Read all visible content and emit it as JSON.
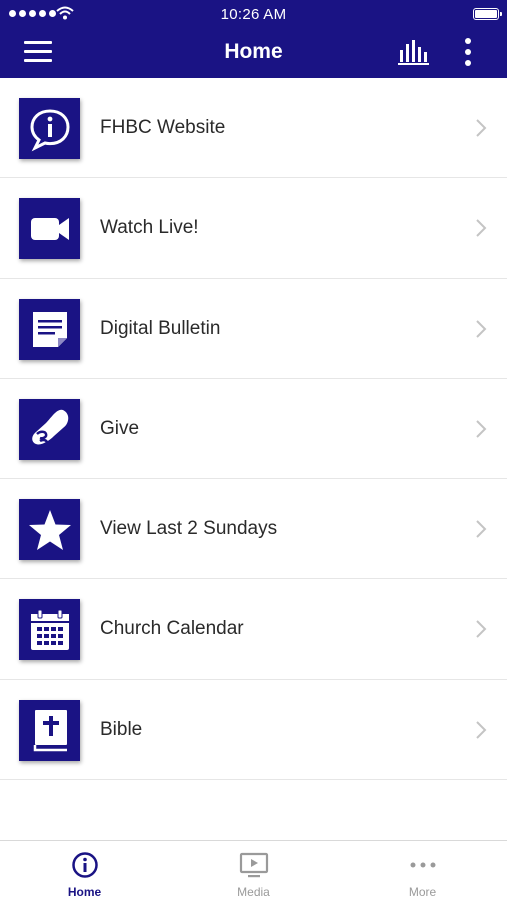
{
  "status": {
    "time": "10:26 AM"
  },
  "header": {
    "title": "Home",
    "menu_icon": "hamburger-icon",
    "chart_icon": "bar-chart-icon",
    "more_icon": "kebab-icon"
  },
  "colors": {
    "brand": "#1a1384",
    "text": "#2a2a2a",
    "inactive": "#9a9a9a"
  },
  "items": [
    {
      "label": "FHBC Website",
      "icon": "info-bubble-icon"
    },
    {
      "label": "Watch Live!",
      "icon": "video-camera-icon"
    },
    {
      "label": "Digital Bulletin",
      "icon": "document-icon"
    },
    {
      "label": "Give",
      "icon": "giving-hand-icon"
    },
    {
      "label": "View Last 2 Sundays",
      "icon": "star-icon"
    },
    {
      "label": "Church Calendar",
      "icon": "calendar-icon"
    },
    {
      "label": "Bible",
      "icon": "bible-icon"
    }
  ],
  "tabs": [
    {
      "label": "Home",
      "icon": "info-circle-icon",
      "active": true
    },
    {
      "label": "Media",
      "icon": "media-play-icon",
      "active": false
    },
    {
      "label": "More",
      "icon": "more-dots-icon",
      "active": false
    }
  ]
}
